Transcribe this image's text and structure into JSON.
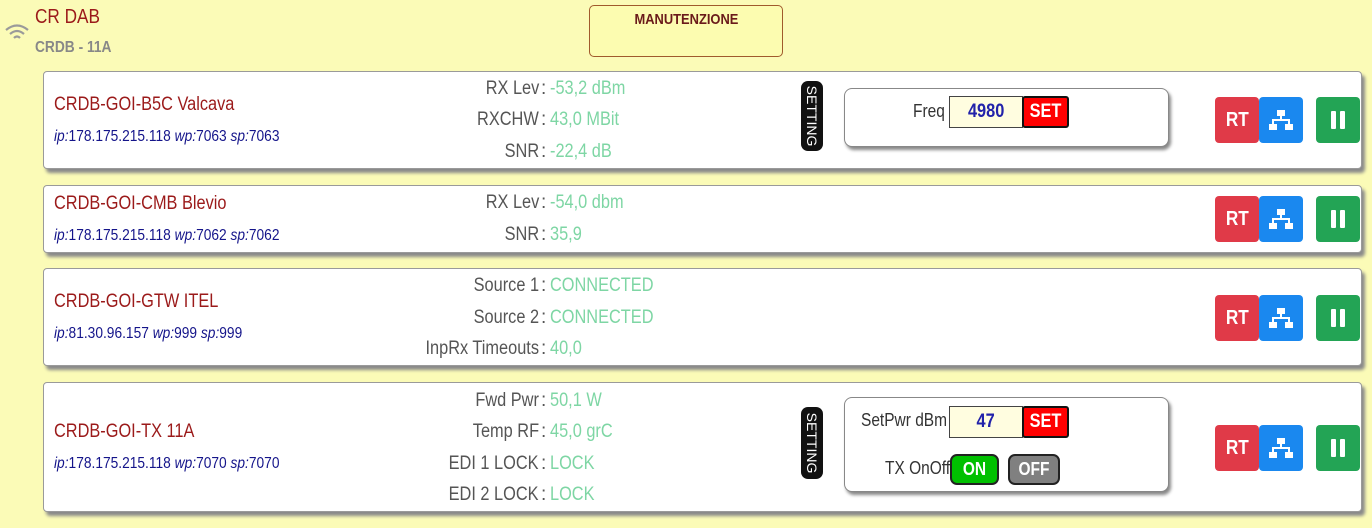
{
  "header": {
    "title": "CR DAB",
    "subtitle": "CRDB - 11A",
    "maintenance_label": "MANUTENZIONE"
  },
  "buttons": {
    "rt": "RT",
    "setting": "SETTING",
    "set": "SET"
  },
  "colors": {
    "background": "#fbfbb7",
    "device_name": "#9b1a1a",
    "ip_text": "#14148a",
    "metric_value": "#7ed6a4",
    "rt_button": "#e03a48",
    "network_button": "#1a88ef",
    "pause_button": "#23a455",
    "set_button": "#ff0000",
    "on_button": "#00c000",
    "off_button": "#808080"
  },
  "icons": {
    "wifi": "wifi-icon",
    "network": "network-icon",
    "pause": "pause-icon"
  },
  "devices": [
    {
      "name": "CRDB-GOI-B5C Valcava",
      "ip_label": "ip:",
      "ip": "178.175.215.118",
      "wp_label": "wp:",
      "wp": "7063",
      "sp_label": "sp:",
      "sp": "7063",
      "metrics": [
        {
          "label": "RX Lev",
          "value": "-53,2 dBm"
        },
        {
          "label": "RXCHW",
          "value": "43,0 MBit"
        },
        {
          "label": "SNR",
          "value": "-22,4 dB"
        }
      ],
      "control": {
        "freq_label": "Freq",
        "freq_value": "4980"
      }
    },
    {
      "name": "CRDB-GOI-CMB Blevio",
      "ip_label": "ip:",
      "ip": "178.175.215.118",
      "wp_label": "wp:",
      "wp": "7062",
      "sp_label": "sp:",
      "sp": "7062",
      "metrics": [
        {
          "label": "RX Lev",
          "value": "-54,0 dbm"
        },
        {
          "label": "SNR",
          "value": "35,9"
        }
      ]
    },
    {
      "name": "CRDB-GOI-GTW ITEL",
      "ip_label": "ip:",
      "ip": "81.30.96.157",
      "wp_label": "wp:",
      "wp": "999",
      "sp_label": "sp:",
      "sp": "999",
      "metrics": [
        {
          "label": "Source 1",
          "value": "CONNECTED"
        },
        {
          "label": "Source 2",
          "value": "CONNECTED"
        },
        {
          "label": "InpRx Timeouts",
          "value": "40,0"
        }
      ]
    },
    {
      "name": "CRDB-GOI-TX 11A",
      "ip_label": "ip:",
      "ip": "178.175.215.118",
      "wp_label": "wp:",
      "wp": "7070",
      "sp_label": "sp:",
      "sp": "7070",
      "metrics": [
        {
          "label": "Fwd Pwr",
          "value": "50,1 W"
        },
        {
          "label": "Temp RF",
          "value": "45,0 grC"
        },
        {
          "label": "EDI 1 LOCK",
          "value": "LOCK"
        },
        {
          "label": "EDI 2 LOCK",
          "value": "LOCK"
        }
      ],
      "control": {
        "setpwr_label": "SetPwr dBm",
        "setpwr_value": "47",
        "txonoff_label": "TX OnOff",
        "on_label": "ON",
        "off_label": "OFF"
      }
    }
  ]
}
